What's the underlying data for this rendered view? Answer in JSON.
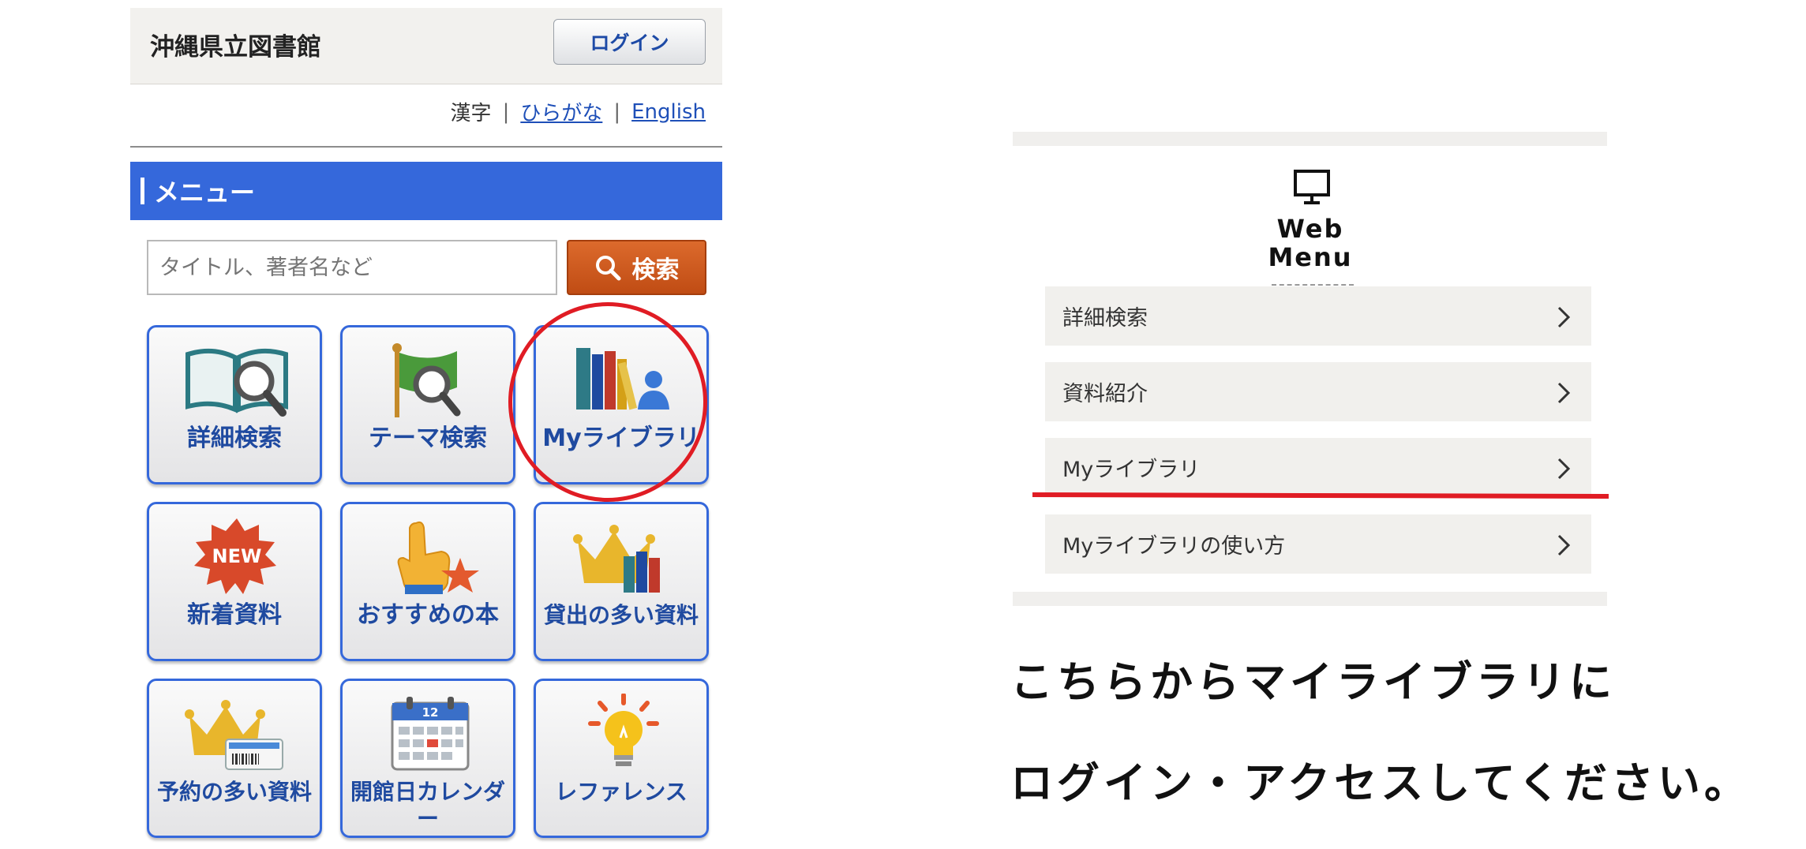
{
  "site": {
    "title": "沖縄県立図書館",
    "login_label": "ログイン"
  },
  "languages": {
    "kanji": "漢字",
    "sep": "|",
    "hiragana": "ひらがな",
    "english": "English"
  },
  "menu_bar": {
    "label": "メニュー"
  },
  "search": {
    "placeholder": "タイトル、著者名など",
    "button_label": "検索"
  },
  "tiles": [
    {
      "label": "詳細検索",
      "icon": "book-magnifier-icon"
    },
    {
      "label": "テーマ検索",
      "icon": "flag-magnifier-icon"
    },
    {
      "label": "Myライブラリ",
      "icon": "books-person-icon"
    },
    {
      "label": "新着資料",
      "icon": "new-badge-icon"
    },
    {
      "label": "おすすめの本",
      "icon": "pointing-hand-star-icon"
    },
    {
      "label": "貸出の多い資料",
      "icon": "crown-books-icon"
    },
    {
      "label": "予約の多い資料",
      "icon": "crown-card-icon"
    },
    {
      "label": "開館日カレンダー",
      "icon": "calendar-icon"
    },
    {
      "label": "レファレンス",
      "icon": "lightbulb-icon"
    }
  ],
  "calendar_day": "12",
  "new_badge": "NEW",
  "web_menu": {
    "title_line1": "Web",
    "title_line2": "Menu",
    "items": [
      "詳細検索",
      "資料紹介",
      "Myライブラリ",
      "Myライブラリの使い方"
    ]
  },
  "notice": {
    "line1": "こちらからマイライブラリに",
    "line2": "ログイン・アクセスしてください。"
  },
  "colors": {
    "accent_blue": "#3568db",
    "search_orange": "#c9561c",
    "highlight_red": "#e01c24"
  }
}
